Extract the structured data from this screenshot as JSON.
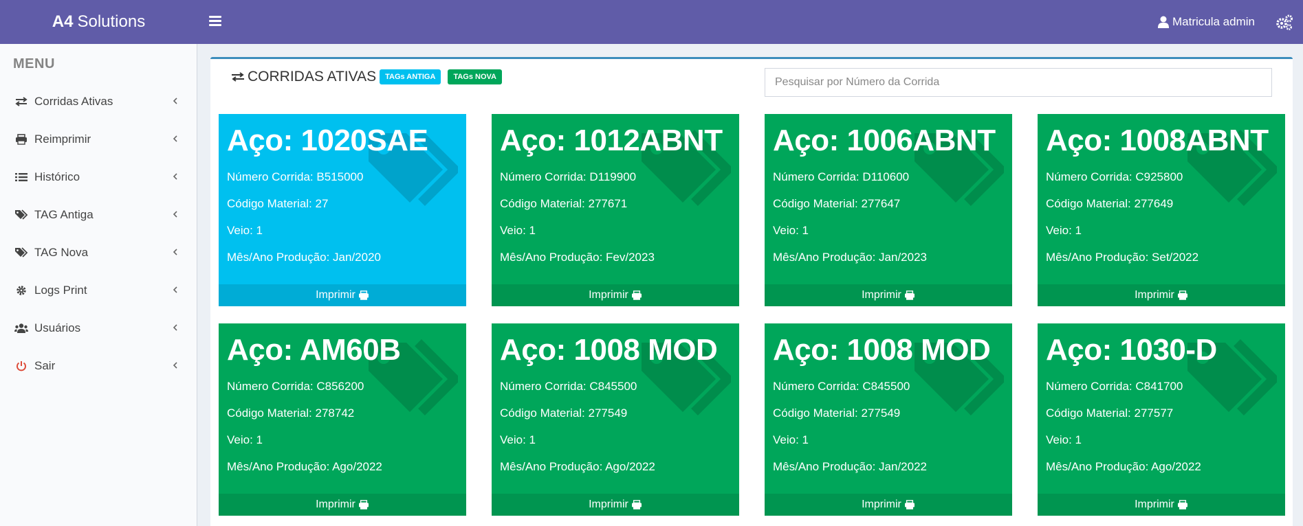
{
  "header": {
    "brand_bold": "A4",
    "brand_rest": "Solutions",
    "user_label": "Matricula admin",
    "colors": {
      "navbar": "#605ca8"
    }
  },
  "sidebar": {
    "header": "MENU",
    "items": [
      {
        "label": "Corridas Ativas",
        "icon": "exchange-icon"
      },
      {
        "label": "Reimprimir",
        "icon": "print-icon"
      },
      {
        "label": "Histórico",
        "icon": "list-icon"
      },
      {
        "label": "TAG Antiga",
        "icon": "tags-icon"
      },
      {
        "label": "TAG Nova",
        "icon": "tags-icon"
      },
      {
        "label": "Logs Print",
        "icon": "gear-icon"
      },
      {
        "label": "Usuários",
        "icon": "users-icon"
      },
      {
        "label": "Sair",
        "icon": "power-icon"
      }
    ]
  },
  "main": {
    "title": "CORRIDAS ATIVAS",
    "badge_old": "TAGs ANTIGA",
    "badge_new": "TAGs NOVA",
    "search_placeholder": "Pesquisar por Número da Corrida",
    "cards": [
      {
        "title": "Aço: 1020SAE",
        "numero": "Número Corrida: B515000",
        "codigo": "Código Material: 27",
        "veio": "Veio: 1",
        "mes": "Mês/Ano Produção: Jan/2020",
        "footer": "Imprimir",
        "color": "#00c0ef"
      },
      {
        "title": "Aço: 1012ABNT",
        "numero": "Número Corrida: D119900",
        "codigo": "Código Material: 277671",
        "veio": "Veio: 1",
        "mes": "Mês/Ano Produção: Fev/2023",
        "footer": "Imprimir",
        "color": "#00a65a"
      },
      {
        "title": "Aço: 1006ABNT",
        "numero": "Número Corrida: D110600",
        "codigo": "Código Material: 277647",
        "veio": "Veio: 1",
        "mes": "Mês/Ano Produção: Jan/2023",
        "footer": "Imprimir",
        "color": "#00a65a"
      },
      {
        "title": "Aço: 1008ABNT",
        "numero": "Número Corrida: C925800",
        "codigo": "Código Material: 277649",
        "veio": "Veio: 1",
        "mes": "Mês/Ano Produção: Set/2022",
        "footer": "Imprimir",
        "color": "#00a65a"
      },
      {
        "title": "Aço: AM60B",
        "numero": "Número Corrida: C856200",
        "codigo": "Código Material: 278742",
        "veio": "Veio: 1",
        "mes": "Mês/Ano Produção: Ago/2022",
        "footer": "Imprimir",
        "color": "#00a65a"
      },
      {
        "title": "Aço: 1008 MOD",
        "numero": "Número Corrida: C845500",
        "codigo": "Código Material: 277549",
        "veio": "Veio: 1",
        "mes": "Mês/Ano Produção: Ago/2022",
        "footer": "Imprimir",
        "color": "#00a65a"
      },
      {
        "title": "Aço: 1008 MOD",
        "numero": "Número Corrida: C845500",
        "codigo": "Código Material: 277549",
        "veio": "Veio: 1",
        "mes": "Mês/Ano Produção: Jan/2022",
        "footer": "Imprimir",
        "color": "#00a65a"
      },
      {
        "title": "Aço: 1030-D",
        "numero": "Número Corrida: C841700",
        "codigo": "Código Material: 277577",
        "veio": "Veio: 1",
        "mes": "Mês/Ano Produção: Ago/2022",
        "footer": "Imprimir",
        "color": "#00a65a"
      }
    ]
  }
}
